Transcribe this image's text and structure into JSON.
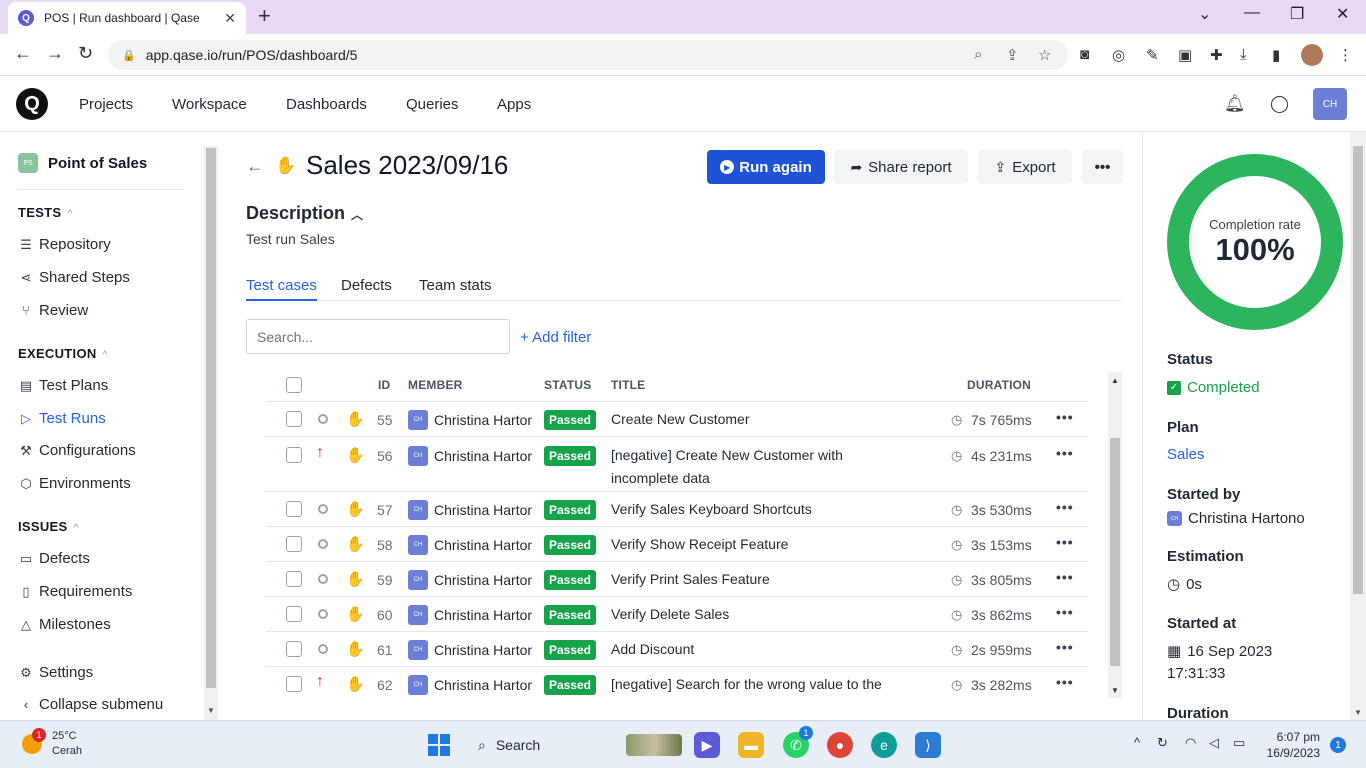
{
  "browser": {
    "tab_title": "POS | Run dashboard | Qase",
    "url": "app.qase.io/run/POS/dashboard/5"
  },
  "header": {
    "nav": [
      "Projects",
      "Workspace",
      "Dashboards",
      "Queries",
      "Apps"
    ],
    "user_initials": "CH"
  },
  "sidebar": {
    "project_badge": "PS",
    "project_name": "Point of Sales",
    "tests_label": "TESTS",
    "tests_items": [
      "Repository",
      "Shared Steps",
      "Review"
    ],
    "execution_label": "EXECUTION",
    "execution_items": [
      "Test Plans",
      "Test Runs",
      "Configurations",
      "Environments"
    ],
    "issues_label": "ISSUES",
    "issues_items": [
      "Defects",
      "Requirements",
      "Milestones"
    ],
    "settings": "Settings",
    "collapse": "Collapse submenu"
  },
  "run": {
    "title": "Sales 2023/09/16",
    "run_again": "Run again",
    "share_report": "Share report",
    "export": "Export",
    "more": "•••",
    "description_heading": "Description",
    "description_text": "Test run Sales",
    "tabs": [
      "Test cases",
      "Defects",
      "Team stats"
    ],
    "search_placeholder": "Search...",
    "add_filter": "+ Add filter"
  },
  "table": {
    "headers": {
      "id": "ID",
      "member": "MEMBER",
      "status": "STATUS",
      "title": "TITLE",
      "duration": "DURATION"
    },
    "rows": [
      {
        "priority": "none",
        "id": "55",
        "member_initials": "CH",
        "member": "Christina Hartono",
        "status": "Passed",
        "title": "Create New Customer",
        "duration": "7s 765ms"
      },
      {
        "priority": "high",
        "id": "56",
        "member_initials": "CH",
        "member": "Christina Hartono",
        "status": "Passed",
        "title": "[negative] Create New Customer with incomplete data",
        "duration": "4s 231ms"
      },
      {
        "priority": "none",
        "id": "57",
        "member_initials": "CH",
        "member": "Christina Hartono",
        "status": "Passed",
        "title": "Verify Sales Keyboard Shortcuts",
        "duration": "3s 530ms"
      },
      {
        "priority": "none",
        "id": "58",
        "member_initials": "CH",
        "member": "Christina Hartono",
        "status": "Passed",
        "title": "Verify Show Receipt Feature",
        "duration": "3s 153ms"
      },
      {
        "priority": "none",
        "id": "59",
        "member_initials": "CH",
        "member": "Christina Hartono",
        "status": "Passed",
        "title": "Verify Print Sales Feature",
        "duration": "3s 805ms"
      },
      {
        "priority": "none",
        "id": "60",
        "member_initials": "CH",
        "member": "Christina Hartono",
        "status": "Passed",
        "title": "Verify Delete Sales",
        "duration": "3s 862ms"
      },
      {
        "priority": "none",
        "id": "61",
        "member_initials": "CH",
        "member": "Christina Hartono",
        "status": "Passed",
        "title": "Add Discount",
        "duration": "2s 959ms"
      },
      {
        "priority": "high",
        "id": "62",
        "member_initials": "CH",
        "member": "Christina Hartono",
        "status": "Passed",
        "title": "[negative] Search for the wrong value to the",
        "duration": "3s 282ms"
      }
    ]
  },
  "stats": {
    "completion_label": "Completion rate",
    "completion_value": "100%",
    "status_label": "Status",
    "status_value": "Completed",
    "plan_label": "Plan",
    "plan_value": "Sales",
    "started_by_label": "Started by",
    "started_by_initials": "CH",
    "started_by_value": "Christina Hartono",
    "estimation_label": "Estimation",
    "estimation_value": "0s",
    "started_at_label": "Started at",
    "started_at_date": "16 Sep 2023",
    "started_at_time": "17:31:33",
    "duration_label": "Duration"
  },
  "taskbar": {
    "weather_badge": "1",
    "temperature": "25°C",
    "condition": "Cerah",
    "search": "Search",
    "whatsapp_badge": "1",
    "time": "6:07 pm",
    "date": "16/9/2023",
    "notifications": "1"
  },
  "colors": {
    "accent": "#1e53d6",
    "passed": "#16a34a",
    "donut": "#2db55d",
    "link": "#2563eb"
  }
}
